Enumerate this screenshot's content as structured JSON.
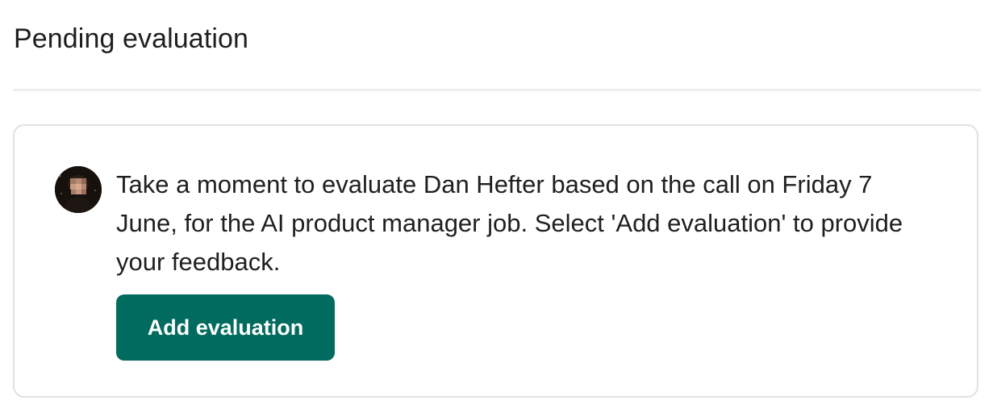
{
  "header": {
    "title": "Pending evaluation"
  },
  "card": {
    "avatar_icon": "person-photo",
    "message": "Take a moment to evaluate Dan Hefter based on the call on Friday 7 June, for the AI product manager job. Select 'Add evaluation' to provide your feedback.",
    "button_label": "Add evaluation"
  },
  "colors": {
    "button_background": "#016b5f",
    "button_text": "#ffffff",
    "card_border": "#dfe1e6",
    "divider": "#eeeeee",
    "text": "#1f1f1f"
  }
}
